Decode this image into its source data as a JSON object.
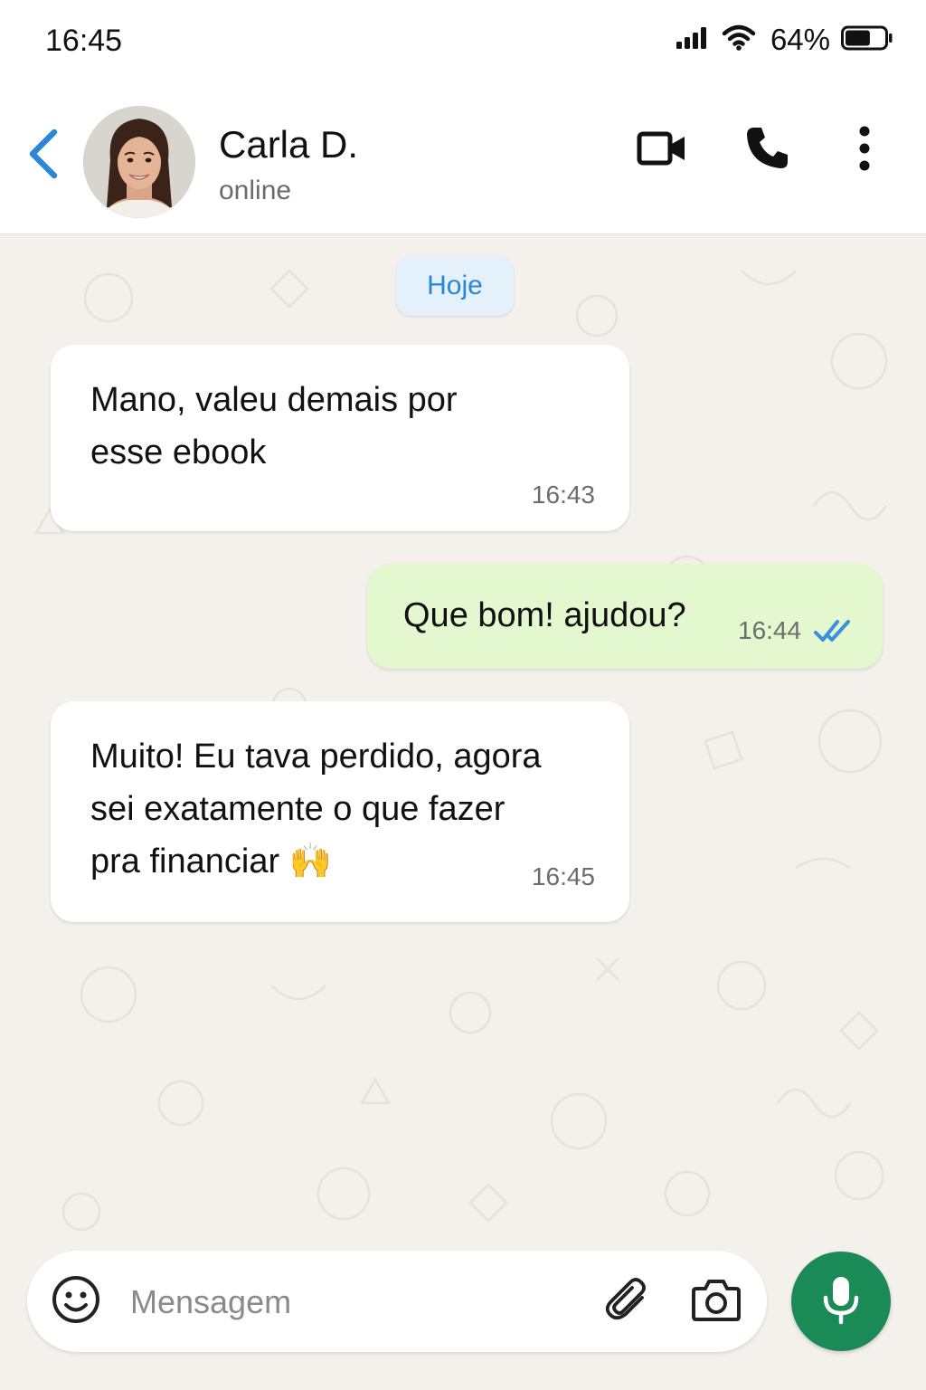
{
  "status_bar": {
    "time": "16:45",
    "battery_percent": "64%",
    "battery_level": 0.64
  },
  "header": {
    "contact_name": "Carla D.",
    "contact_status": "online",
    "icons": [
      "back-arrow-icon",
      "video-camera-icon",
      "phone-icon",
      "more-vertical-icon"
    ]
  },
  "chat": {
    "date_label": "Hoje",
    "messages": [
      {
        "direction": "incoming",
        "lines": [
          "Mano, valeu demais por",
          "esse ebook"
        ],
        "time": "16:43"
      },
      {
        "direction": "outgoing",
        "lines": [
          "Que bom! ajudou?"
        ],
        "time": "16:44",
        "read": true
      },
      {
        "direction": "incoming",
        "lines": [
          "Muito! Eu tava perdido, agora",
          "sei exatamente o que fazer",
          "pra financiar 🙌"
        ],
        "time": "16:45"
      }
    ]
  },
  "composer": {
    "placeholder": "Mensagem",
    "value": "",
    "icons": [
      "emoji-icon",
      "attachment-icon",
      "camera-icon",
      "microphone-icon"
    ]
  },
  "colors": {
    "accent_blue": "#2a86d6",
    "outgoing_bubble": "#e3f8cf",
    "incoming_bubble": "#ffffff",
    "chat_background": "#f4f1ec",
    "mic_button": "#1a8a56",
    "read_ticks": "#3a8fe0"
  }
}
